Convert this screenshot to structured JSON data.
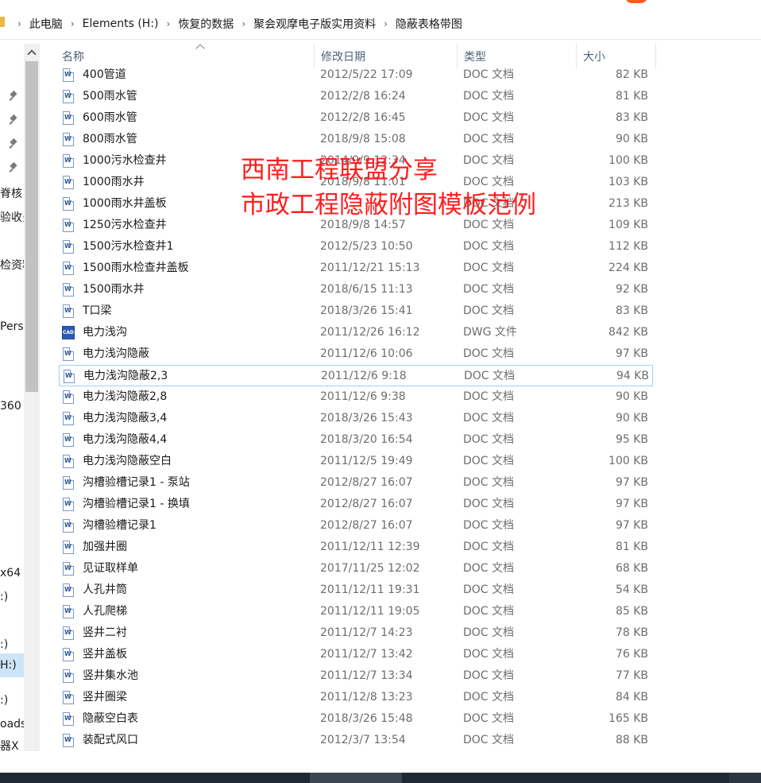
{
  "breadcrumb": {
    "items": [
      "此电脑",
      "Elements (H:)",
      "恢复的数据",
      "聚会观摩电子版实用资料",
      "隐蔽表格带图"
    ],
    "separator": "›"
  },
  "nav_pane": {
    "items": [
      "脊核",
      "验收多",
      "检资料",
      "Perso",
      "360",
      "x64",
      ":)",
      ":)",
      "H:)",
      ":)",
      "oads",
      "器X"
    ],
    "selected_index": 8
  },
  "columns": {
    "name": "名称",
    "date": "修改日期",
    "type": "类型",
    "size": "大小"
  },
  "files": [
    {
      "name": "400管道",
      "date": "2012/5/22 17:09",
      "type": "DOC 文档",
      "size": "82 KB",
      "icon": "word-doc-icon"
    },
    {
      "name": "500雨水管",
      "date": "2012/2/8 16:24",
      "type": "DOC 文档",
      "size": "81 KB",
      "icon": "word-doc-icon"
    },
    {
      "name": "600雨水管",
      "date": "2012/2/8 16:45",
      "type": "DOC 文档",
      "size": "83 KB",
      "icon": "word-doc-icon"
    },
    {
      "name": "800雨水管",
      "date": "2018/9/8 15:08",
      "type": "DOC 文档",
      "size": "90 KB",
      "icon": "word-doc-icon"
    },
    {
      "name": "1000污水检查井",
      "date": "2014/9/9 12:34",
      "type": "DOC 文档",
      "size": "100 KB",
      "icon": "word-doc-icon"
    },
    {
      "name": "1000雨水井",
      "date": "2018/9/8 11:01",
      "type": "DOC 文档",
      "size": "103 KB",
      "icon": "word-doc-icon"
    },
    {
      "name": "1000雨水井盖板",
      "date": "",
      "type": "DOC 文档",
      "size": "213 KB",
      "icon": "word-doc-icon"
    },
    {
      "name": "1250污水检查井",
      "date": "2018/9/8 14:57",
      "type": "DOC 文档",
      "size": "109 KB",
      "icon": "word-doc-icon"
    },
    {
      "name": "1500污水检查井1",
      "date": "2012/5/23 10:50",
      "type": "DOC 文档",
      "size": "112 KB",
      "icon": "word-doc-icon"
    },
    {
      "name": "1500雨水检查井盖板",
      "date": "2011/12/21 15:13",
      "type": "DOC 文档",
      "size": "224 KB",
      "icon": "word-doc-icon"
    },
    {
      "name": "1500雨水井",
      "date": "2018/6/15 11:13",
      "type": "DOC 文档",
      "size": "92 KB",
      "icon": "word-doc-icon"
    },
    {
      "name": "T口梁",
      "date": "2018/3/26 15:41",
      "type": "DOC 文档",
      "size": "83 KB",
      "icon": "word-doc-icon"
    },
    {
      "name": "电力浅沟",
      "date": "2011/12/26 16:12",
      "type": "DWG 文件",
      "size": "842 KB",
      "icon": "cad-dwg-icon"
    },
    {
      "name": "电力浅沟隐蔽",
      "date": "2011/12/6 10:06",
      "type": "DOC 文档",
      "size": "97 KB",
      "icon": "word-doc-icon"
    },
    {
      "name": "电力浅沟隐蔽2,3",
      "date": "2011/12/6 9:18",
      "type": "DOC 文档",
      "size": "94 KB",
      "icon": "word-doc-icon"
    },
    {
      "name": "电力浅沟隐蔽2,8",
      "date": "2011/12/6 9:38",
      "type": "DOC 文档",
      "size": "90 KB",
      "icon": "word-doc-icon"
    },
    {
      "name": "电力浅沟隐蔽3,4",
      "date": "2018/3/26 15:43",
      "type": "DOC 文档",
      "size": "90 KB",
      "icon": "word-doc-icon"
    },
    {
      "name": "电力浅沟隐蔽4,4",
      "date": "2018/3/20 16:54",
      "type": "DOC 文档",
      "size": "95 KB",
      "icon": "word-doc-icon"
    },
    {
      "name": "电力浅沟隐蔽空白",
      "date": "2011/12/5 19:49",
      "type": "DOC 文档",
      "size": "100 KB",
      "icon": "word-doc-icon"
    },
    {
      "name": "沟槽验槽记录1 - 泵站",
      "date": "2012/8/27 16:07",
      "type": "DOC 文档",
      "size": "97 KB",
      "icon": "word-doc-icon"
    },
    {
      "name": "沟槽验槽记录1 - 换填",
      "date": "2012/8/27 16:07",
      "type": "DOC 文档",
      "size": "97 KB",
      "icon": "word-doc-icon"
    },
    {
      "name": "沟槽验槽记录1",
      "date": "2012/8/27 16:07",
      "type": "DOC 文档",
      "size": "97 KB",
      "icon": "word-doc-icon"
    },
    {
      "name": "加强井圈",
      "date": "2011/12/11 12:39",
      "type": "DOC 文档",
      "size": "81 KB",
      "icon": "word-doc-icon"
    },
    {
      "name": "见证取样单",
      "date": "2017/11/25 12:02",
      "type": "DOC 文档",
      "size": "68 KB",
      "icon": "word-doc-icon"
    },
    {
      "name": "人孔井筒",
      "date": "2011/12/11 19:31",
      "type": "DOC 文档",
      "size": "54 KB",
      "icon": "word-doc-icon"
    },
    {
      "name": "人孔爬梯",
      "date": "2011/12/11 19:05",
      "type": "DOC 文档",
      "size": "85 KB",
      "icon": "word-doc-icon"
    },
    {
      "name": "竖井二衬",
      "date": "2011/12/7 14:23",
      "type": "DOC 文档",
      "size": "78 KB",
      "icon": "word-doc-icon"
    },
    {
      "name": "竖井盖板",
      "date": "2011/12/7 13:42",
      "type": "DOC 文档",
      "size": "76 KB",
      "icon": "word-doc-icon"
    },
    {
      "name": "竖井集水池",
      "date": "2011/12/7 13:34",
      "type": "DOC 文档",
      "size": "77 KB",
      "icon": "word-doc-icon"
    },
    {
      "name": "竖井圈梁",
      "date": "2011/12/8 13:23",
      "type": "DOC 文档",
      "size": "84 KB",
      "icon": "word-doc-icon"
    },
    {
      "name": "隐蔽空白表",
      "date": "2018/3/26 15:48",
      "type": "DOC 文档",
      "size": "165 KB",
      "icon": "word-doc-icon"
    },
    {
      "name": "装配式风口",
      "date": "2012/3/7 13:54",
      "type": "DOC 文档",
      "size": "88 KB",
      "icon": "word-doc-icon"
    }
  ],
  "focused_index": 14,
  "watermark": {
    "line1": "西南工程联盟分享",
    "line2": "市政工程隐蔽附图模板范例",
    "color": "#ff1d1d"
  },
  "colors": {
    "header_text": "#4c6077",
    "selection": "#cce4f7",
    "focus_border": "#99d1ff"
  }
}
